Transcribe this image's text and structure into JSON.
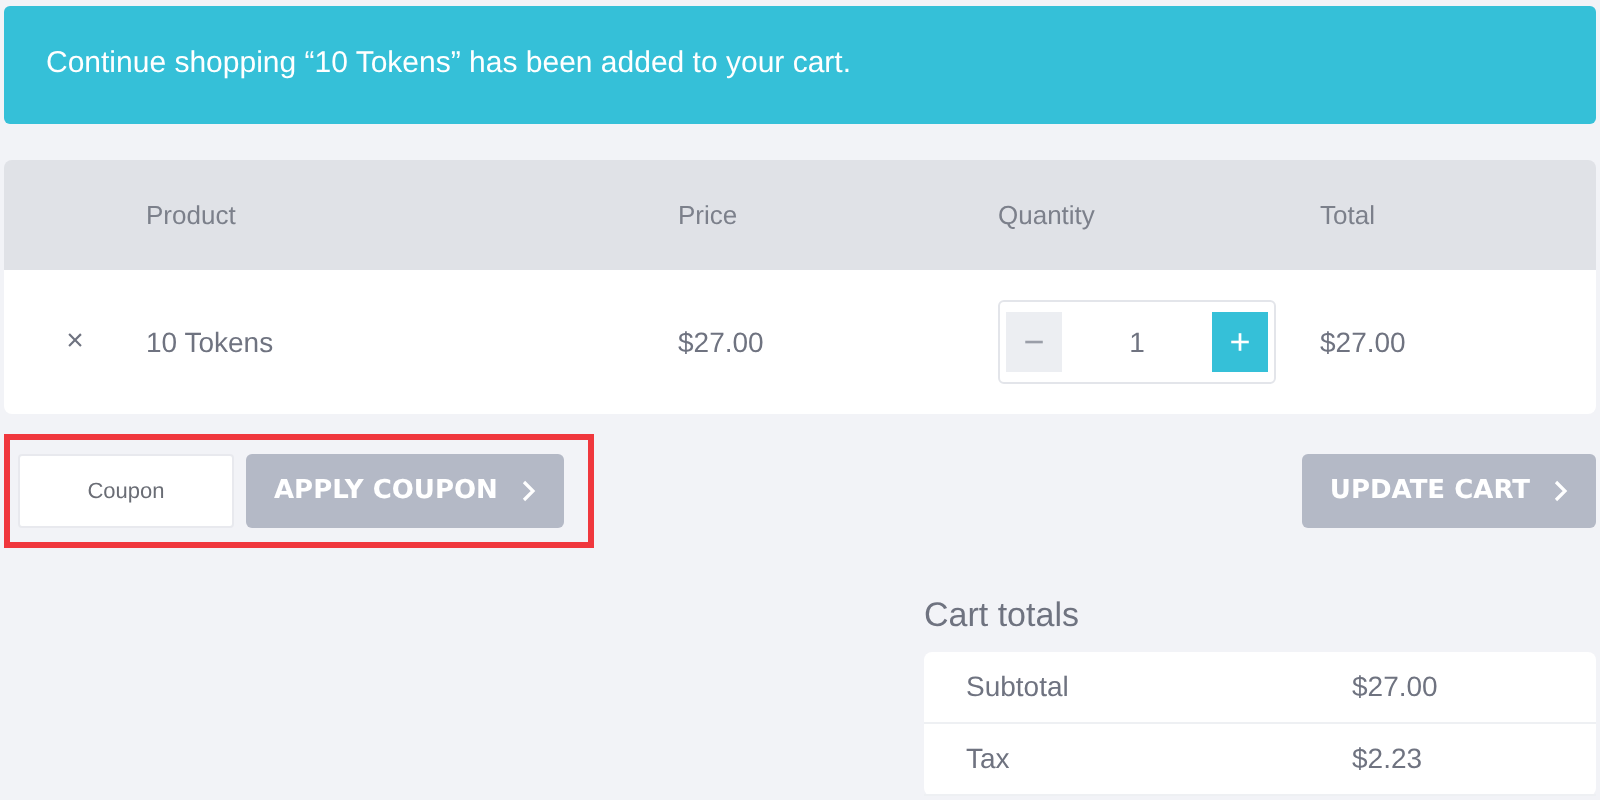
{
  "notice": {
    "text": "Continue shopping “10 Tokens” has been added to your cart."
  },
  "cart_table": {
    "columns": [
      "Product",
      "Price",
      "Quantity",
      "Total"
    ],
    "rows": [
      {
        "remove": "×",
        "product": "10 Tokens",
        "price": "$27.00",
        "quantity": {
          "minus": "−",
          "value": "1",
          "plus": "+"
        },
        "total": "$27.00"
      }
    ]
  },
  "coupon": {
    "placeholder": "Coupon",
    "highlighted": true,
    "apply_button": "APPLY COUPON"
  },
  "update_button": "UPDATE CART",
  "cart_totals": {
    "title": "Cart totals",
    "rows": [
      {
        "label": "Subtotal",
        "value": "$27.00"
      },
      {
        "label": "Tax",
        "value": "$2.23"
      }
    ]
  }
}
